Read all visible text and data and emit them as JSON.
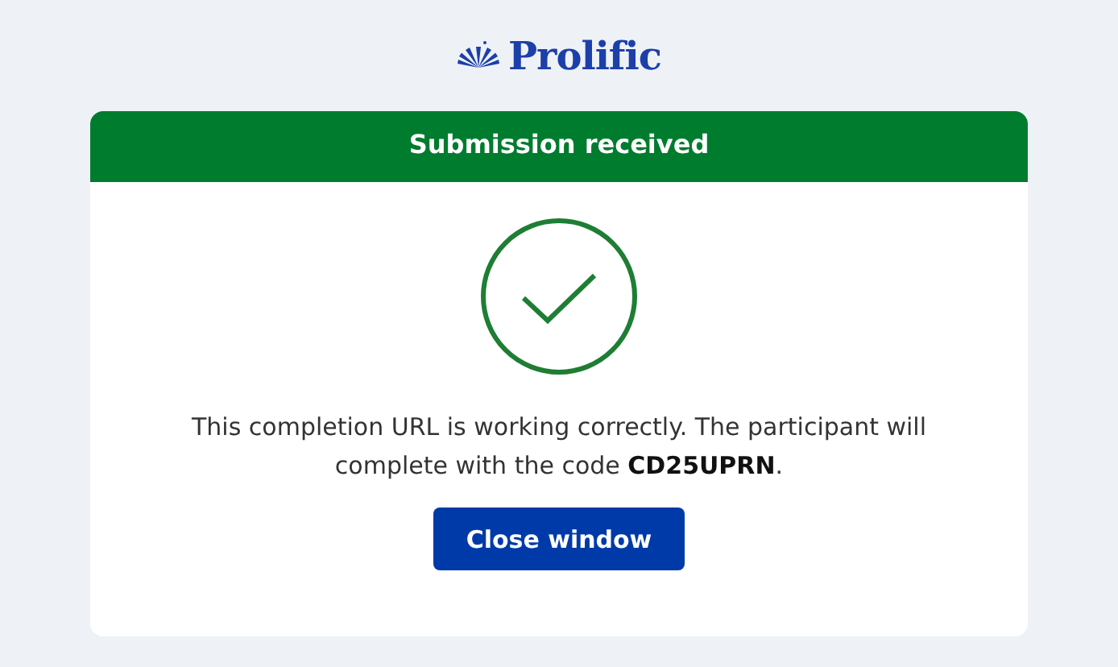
{
  "logo": {
    "text": "Prolific"
  },
  "card": {
    "header": "Submission received",
    "message": "This completion URL is working correctly. The participant will complete with the code **CD25UPRN**.",
    "button": "Close window"
  }
}
